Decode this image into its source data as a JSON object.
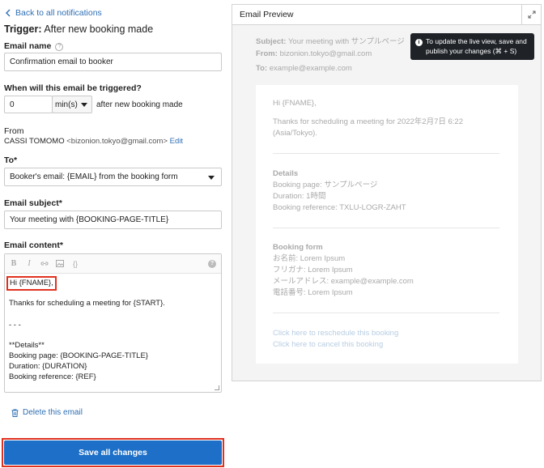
{
  "back_link": "Back to all notifications",
  "trigger": {
    "prefix": "Trigger:",
    "name": "After new booking made"
  },
  "email_name": {
    "label": "Email name",
    "value": "Confirmation email to booker"
  },
  "when": {
    "label": "When will this email be triggered?",
    "number": "0",
    "unit": "min(s)",
    "suffix": "after new booking made"
  },
  "from": {
    "label": "From",
    "name": "CASSI TOMOMO",
    "email": "<bizonion.tokyo@gmail.com>",
    "edit": "Edit"
  },
  "to": {
    "label": "To*",
    "value": "Booker's email: {EMAIL} from the booking form"
  },
  "subject": {
    "label": "Email subject*",
    "value": "Your meeting with {BOOKING-PAGE-TITLE}"
  },
  "content": {
    "label": "Email content*",
    "lines": [
      "Hi {FNAME},",
      "Thanks for scheduling a meeting for {START}.",
      "- - -",
      "**Details**",
      "Booking page: {BOOKING-PAGE-TITLE}",
      "Duration: {DURATION}",
      "Booking reference: {REF}"
    ]
  },
  "delete_label": "Delete this email",
  "save_label": "Save all changes",
  "preview": {
    "title": "Email Preview",
    "subject_label": "Subject:",
    "subject_value": "Your meeting with サンプルページ",
    "from_label": "From:",
    "from_value": "bizonion.tokyo@gmail.com",
    "to_label": "To:",
    "to_value": "example@example.com",
    "tooltip": [
      "To update the live view, save and",
      "publish your changes (⌘ + S)"
    ],
    "body": {
      "greeting": "Hi {FNAME},",
      "thanks": [
        "Thanks for scheduling a meeting for 2022年2月7日 6:22",
        "(Asia/Tokyo)."
      ],
      "details_title": "Details",
      "details": [
        "Booking page: サンプルページ",
        "Duration: 1時間",
        "Booking reference: TXLU-LOGR-ZAHT"
      ],
      "form_title": "Booking form",
      "form": [
        "お名前: Lorem Ipsum",
        "フリガナ: Lorem Ipsum",
        "メールアドレス: example@example.com",
        "電話番号: Lorem Ipsum"
      ],
      "reschedule": "Click here to reschedule this booking",
      "cancel": "Click here to cancel this booking"
    }
  }
}
